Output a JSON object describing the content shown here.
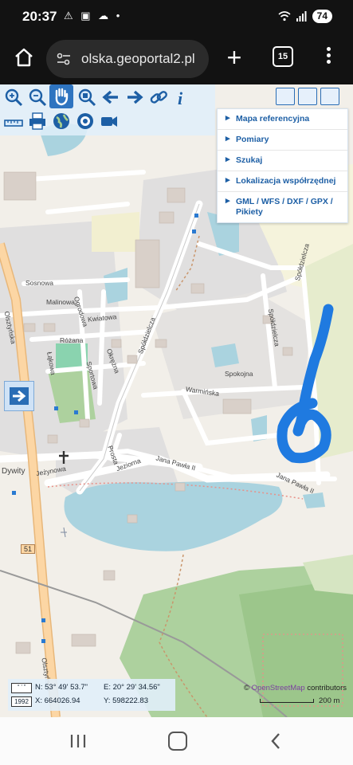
{
  "status_bar": {
    "time": "20:37",
    "notif_icons": "⚠ ▣ ☁ •",
    "battery": "74"
  },
  "browser": {
    "url": "olska.geoportal2.pl",
    "tab_count": "15"
  },
  "toolbar": {
    "row1_icons": [
      "zoom-in-icon",
      "zoom-out-icon",
      "pan-hand-icon",
      "zoom-window-icon",
      "back-arrow-icon",
      "forward-arrow-icon",
      "link-icon",
      "info-icon"
    ],
    "row2_icons": [
      "ruler-icon",
      "print-icon",
      "globe-icon",
      "target-icon",
      "camera-icon"
    ]
  },
  "menu": {
    "items": [
      "Mapa referencyjna",
      "Pomiary",
      "Szukaj",
      "Lokalizacja współrzędnej",
      "GML / WFS / DXF / GPX / Pikiety"
    ]
  },
  "map_labels": {
    "olsztynska": "Olsztyńska",
    "sosnowa": "Sosnowa",
    "malinowa": "Malinowa",
    "ogrodowa": "Ogrodowa",
    "kwiatowa": "Kwiatowa",
    "rozana": "Różana",
    "lakowa": "Łąkowa",
    "sportowa": "Sportowa",
    "okrezna": "Okrężna",
    "spoldzielcza": "Spółdzielcza",
    "spoldzielcza2": "Spółdzielcza",
    "spoldzielcza3": "Spółdzielcza",
    "spokojna": "Spokojna",
    "warminska": "Warmińska",
    "prosta": "Prosta",
    "jeziorna": "Jeziorna",
    "jezynowa": "Jeżynowa",
    "dywity": "Dywity",
    "jana_pawla": "Jana Pawła II",
    "jana_pawla2": "Jana Pawła II",
    "road_51": "51",
    "olsztynska2": "Olsztyńska"
  },
  "coords": {
    "dms": "° ' \"",
    "epsg": "1992",
    "n": "N: 53° 49' 53.7\"",
    "e": "E: 20° 29' 34.56\"",
    "x": "X: 664026.94",
    "y": "Y: 598222.83"
  },
  "attribution": {
    "symbol": "©",
    "osm": "OpenStreetMap",
    "rest": " contributors"
  },
  "scale_label": "200 m",
  "colors": {
    "drawn_path": "#1f7ae0",
    "lake": "#aad3df",
    "forest": "#add19e",
    "road_primary": "#fcd6a4"
  }
}
